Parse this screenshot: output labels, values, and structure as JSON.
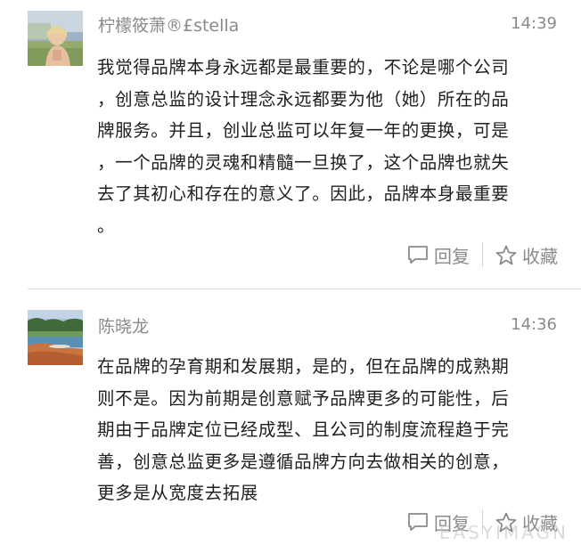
{
  "comments": [
    {
      "username": "柠檬筱萧®£stella",
      "time": "14:39",
      "avatar_icon": "avatar-photo-child",
      "lines": [
        "我觉得品牌本身永远都是最重要的，不论是哪个公司",
        "，创意总监的设计理念永远都要为他（她）所在的品",
        "牌服务。并且，创业总监可以年复一年的更换，可是",
        "，一个品牌的灵魂和精髓一旦换了，这个品牌也就失",
        "去了其初心和存在的意义了。因此，品牌本身最重要",
        "。"
      ],
      "reply_label": "回复",
      "favorite_label": "收藏"
    },
    {
      "username": "陈晓龙",
      "time": "14:36",
      "avatar_icon": "avatar-photo-landscape",
      "lines": [
        "在品牌的孕育期和发展期，是的，但在品牌的成熟期",
        "则不是。因为前期是创意赋予品牌更多的可能性，后",
        "期由于品牌定位已经成型、且公司的制度流程趋于完",
        "善，创意总监更多是遵循品牌方向去做相关的创意，",
        "更多是从宽度去拓展"
      ],
      "reply_label": "回复",
      "favorite_label": "收藏"
    }
  ],
  "icons": {
    "reply": "comment-bubble-icon",
    "favorite": "star-outline-icon"
  },
  "colors": {
    "meta_text": "#8a8a8a",
    "body_text": "#1e1e1e",
    "separator": "#dcdcdc"
  },
  "watermark": "EASYIMAGN"
}
